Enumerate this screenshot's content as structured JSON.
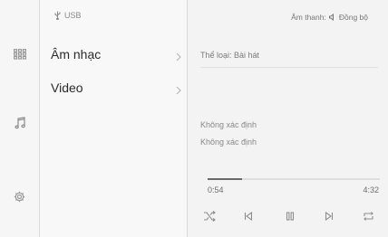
{
  "left_rail": {
    "items": [
      {
        "name": "apps-icon",
        "active": false
      },
      {
        "name": "music-note-icon",
        "active": true
      },
      {
        "name": "settings-icon",
        "active": false
      }
    ]
  },
  "source": {
    "label": "USB",
    "icon": "usb-icon"
  },
  "menu": {
    "items": [
      {
        "label": "Âm nhạc",
        "icon": "chevron-right-icon"
      },
      {
        "label": "Video",
        "icon": "chevron-right-icon"
      }
    ]
  },
  "player": {
    "sound_sync_label": "Âm thanh:",
    "sound_sync_value": "Đồng bộ",
    "sound_sync_icon": "speaker-icon",
    "genre": "Thể loại: Bài hát",
    "artist": "Không xác định",
    "album": "Không xác định",
    "elapsed": "0:54",
    "duration": "4:32",
    "progress_fraction": 0.2,
    "controls": [
      {
        "name": "shuffle-icon"
      },
      {
        "name": "previous-track-icon"
      },
      {
        "name": "pause-icon"
      },
      {
        "name": "next-track-icon"
      },
      {
        "name": "repeat-icon"
      }
    ]
  },
  "colors": {
    "background": "#f3f3f3",
    "divider": "#dcdcdc",
    "text_primary": "#2b2b2b",
    "text_secondary": "#8a8a8a"
  }
}
